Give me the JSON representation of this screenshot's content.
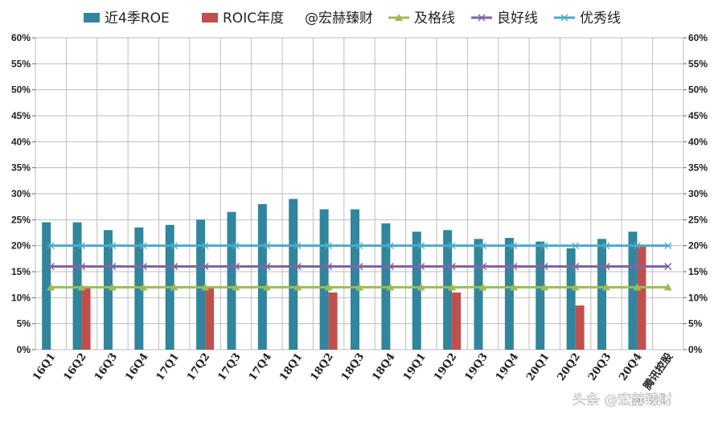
{
  "chart_data": {
    "type": "bar",
    "categories": [
      "16Q1",
      "16Q2",
      "16Q3",
      "16Q4",
      "17Q1",
      "17Q2",
      "17Q3",
      "17Q4",
      "18Q1",
      "18Q2",
      "18Q3",
      "18Q4",
      "19Q1",
      "19Q2",
      "19Q3",
      "19Q4",
      "20Q1",
      "20Q2",
      "20Q3",
      "20Q4"
    ],
    "series": [
      {
        "name": "近4季ROE",
        "kind": "bar",
        "color": "#31859c",
        "values": [
          24.5,
          24.5,
          23.0,
          23.5,
          24.0,
          25.0,
          26.5,
          28.0,
          29.0,
          27.0,
          27.0,
          24.3,
          22.7,
          23.0,
          21.3,
          21.5,
          20.8,
          19.5,
          21.3,
          22.7
        ]
      },
      {
        "name": "ROIC年度",
        "kind": "bar",
        "color": "#c0504d",
        "values": [
          null,
          12.0,
          null,
          null,
          null,
          12.0,
          null,
          null,
          null,
          11.0,
          null,
          null,
          null,
          11.0,
          null,
          null,
          null,
          8.5,
          null,
          19.8
        ]
      },
      {
        "name": "及格线",
        "kind": "line",
        "color": "#9bbb59",
        "marker": "triangle",
        "value": 12
      },
      {
        "name": "良好线",
        "kind": "line",
        "color": "#8064a2",
        "marker": "x",
        "value": 16
      },
      {
        "name": "优秀线",
        "kind": "line",
        "color": "#4bacc6",
        "marker": "star",
        "value": 20
      }
    ],
    "extra_category": "腾讯控股",
    "y_ticks": [
      "0%",
      "5%",
      "10%",
      "15%",
      "20%",
      "25%",
      "30%",
      "35%",
      "40%",
      "45%",
      "50%",
      "55%",
      "60%"
    ],
    "ylim": [
      0,
      60
    ],
    "grid": true,
    "legend_position": "top",
    "legend_note": "@宏赫臻财"
  },
  "watermark": "头条 @宏赫臻财"
}
